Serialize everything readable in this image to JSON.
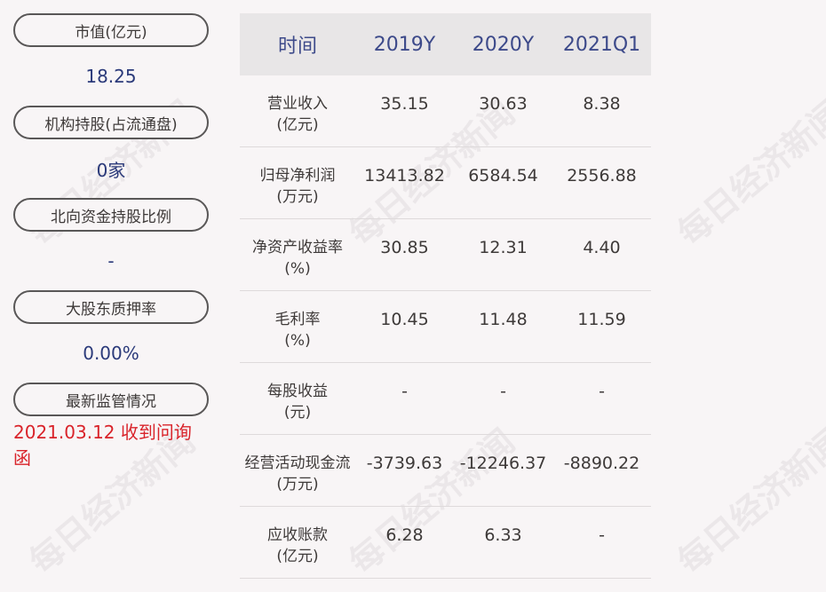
{
  "left": {
    "items": [
      {
        "label": "市值(亿元)",
        "value": "18.25"
      },
      {
        "label": "机构持股(占流通盘)",
        "value": "0家"
      },
      {
        "label": "北向资金持股比例",
        "value": "-"
      },
      {
        "label": "大股东质押率",
        "value": "0.00%"
      },
      {
        "label": "最新监管情况",
        "value": "2021.03.12 收到问询函"
      }
    ]
  },
  "table": {
    "headers": [
      "时间",
      "2019Y",
      "2020Y",
      "2021Q1"
    ],
    "rows": [
      {
        "label1": "营业收入",
        "label2": "(亿元)",
        "v1": "35.15",
        "v2": "30.63",
        "v3": "8.38"
      },
      {
        "label1": "归母净利润",
        "label2": "(万元)",
        "v1": "13413.82",
        "v2": "6584.54",
        "v3": "2556.88"
      },
      {
        "label1": "净资产收益率",
        "label2": "(%)",
        "v1": "30.85",
        "v2": "12.31",
        "v3": "4.40"
      },
      {
        "label1": "毛利率",
        "label2": "(%)",
        "v1": "10.45",
        "v2": "11.48",
        "v3": "11.59"
      },
      {
        "label1": "每股收益",
        "label2": "(元)",
        "v1": "-",
        "v2": "-",
        "v3": "-"
      },
      {
        "label1": "经营活动现金流",
        "label2": "(万元)",
        "v1": "-3739.63",
        "v2": "-12246.37",
        "v3": "-8890.22"
      },
      {
        "label1": "应收账款",
        "label2": "(亿元)",
        "v1": "6.28",
        "v2": "6.33",
        "v3": "-"
      }
    ]
  },
  "watermark": "每日经济新闻",
  "colors": {
    "accent": "#2b3a7a",
    "alert": "#d9232a",
    "header_bg": "#e8e6e7"
  }
}
